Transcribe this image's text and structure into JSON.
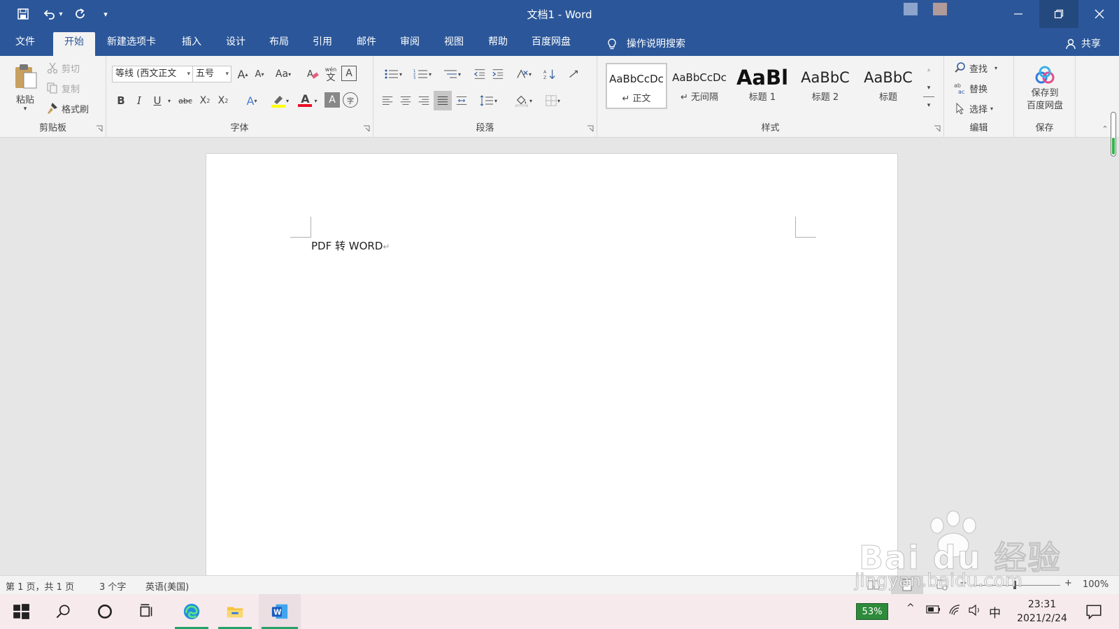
{
  "titlebar": {
    "doc_name": "文档1",
    "separator": " - ",
    "app_name": "Word",
    "customize_arrow": "▾"
  },
  "tabs": [
    {
      "label": "文件"
    },
    {
      "label": "开始"
    },
    {
      "label": "新建选项卡"
    },
    {
      "label": "插入"
    },
    {
      "label": "设计"
    },
    {
      "label": "布局"
    },
    {
      "label": "引用"
    },
    {
      "label": "邮件"
    },
    {
      "label": "审阅"
    },
    {
      "label": "视图"
    },
    {
      "label": "帮助"
    },
    {
      "label": "百度网盘"
    }
  ],
  "tell_me": {
    "label": "操作说明搜索"
  },
  "share": {
    "label": "共享"
  },
  "clipboard": {
    "group_label": "剪贴板",
    "paste": "粘贴",
    "cut": "剪切",
    "copy": "复制",
    "format_painter": "格式刷"
  },
  "font": {
    "group_label": "字体",
    "font_name": "等线 (西文正文",
    "font_size": "五号",
    "grow": "A",
    "shrink": "A",
    "change_case": "Aa",
    "phonetic": "文",
    "char_border": "A",
    "bold": "B",
    "italic": "I",
    "underline": "U",
    "strike": "abc",
    "subscript": "X",
    "superscript": "X",
    "text_effects": "A",
    "font_color": "A",
    "char_shading": "A",
    "enclose": "字"
  },
  "paragraph": {
    "group_label": "段落"
  },
  "styles": {
    "group_label": "样式",
    "items": [
      {
        "preview": "AaBbCcDc",
        "name": "↵ 正文"
      },
      {
        "preview": "AaBbCcDc",
        "name": "↵ 无间隔"
      },
      {
        "preview": "AaBl",
        "name": "标题 1"
      },
      {
        "preview": "AaBbC",
        "name": "标题 2"
      },
      {
        "preview": "AaBbC",
        "name": "标题"
      }
    ]
  },
  "editing": {
    "group_label": "编辑",
    "find": "查找",
    "replace": "替换",
    "select": "选择"
  },
  "save_group": {
    "group_label": "保存",
    "button": "保存到\n百度网盘"
  },
  "document": {
    "text": "PDF 转 WORD",
    "para_mark": "↵"
  },
  "statusbar": {
    "page": "第 1 页，共 1 页",
    "words": "3 个字",
    "language": "英语(美国)",
    "zoom": "100%",
    "zoom_minus": "−",
    "zoom_plus": "+"
  },
  "taskbar": {
    "battery_percent": "53%",
    "ime": "中",
    "time": "23:31",
    "date": "2021/2/24"
  },
  "watermark": {
    "logo": "Bai du 经验",
    "url": "jingyan.baidu.com"
  },
  "colors": {
    "accent": "#2b579a",
    "ribbon_bg": "#f3f3f3",
    "canvas_bg": "#e6e6e6",
    "font_color_bar": "#e81123",
    "highlight_bar": "#ffff00",
    "battery_green": "#2e8b3b"
  }
}
